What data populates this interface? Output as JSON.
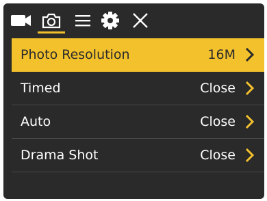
{
  "toolbar": {
    "tabs": [
      {
        "icon": "video-camera-icon",
        "selected": false
      },
      {
        "icon": "photo-camera-icon",
        "selected": true
      },
      {
        "icon": "menu-list-icon",
        "selected": false
      },
      {
        "icon": "settings-gear-icon",
        "selected": false
      },
      {
        "icon": "close-icon",
        "selected": false
      }
    ]
  },
  "menu": {
    "items": [
      {
        "label": "Photo Resolution",
        "value": "16M",
        "active": true
      },
      {
        "label": "Timed",
        "value": "Close",
        "active": false
      },
      {
        "label": "Auto",
        "value": "Close",
        "active": false
      },
      {
        "label": "Drama Shot",
        "value": "Close",
        "active": false
      }
    ]
  },
  "colors": {
    "background": "#2a2a2a",
    "accent": "#f3c12c",
    "text": "#ffffff",
    "divider": "#4a4a4a"
  }
}
